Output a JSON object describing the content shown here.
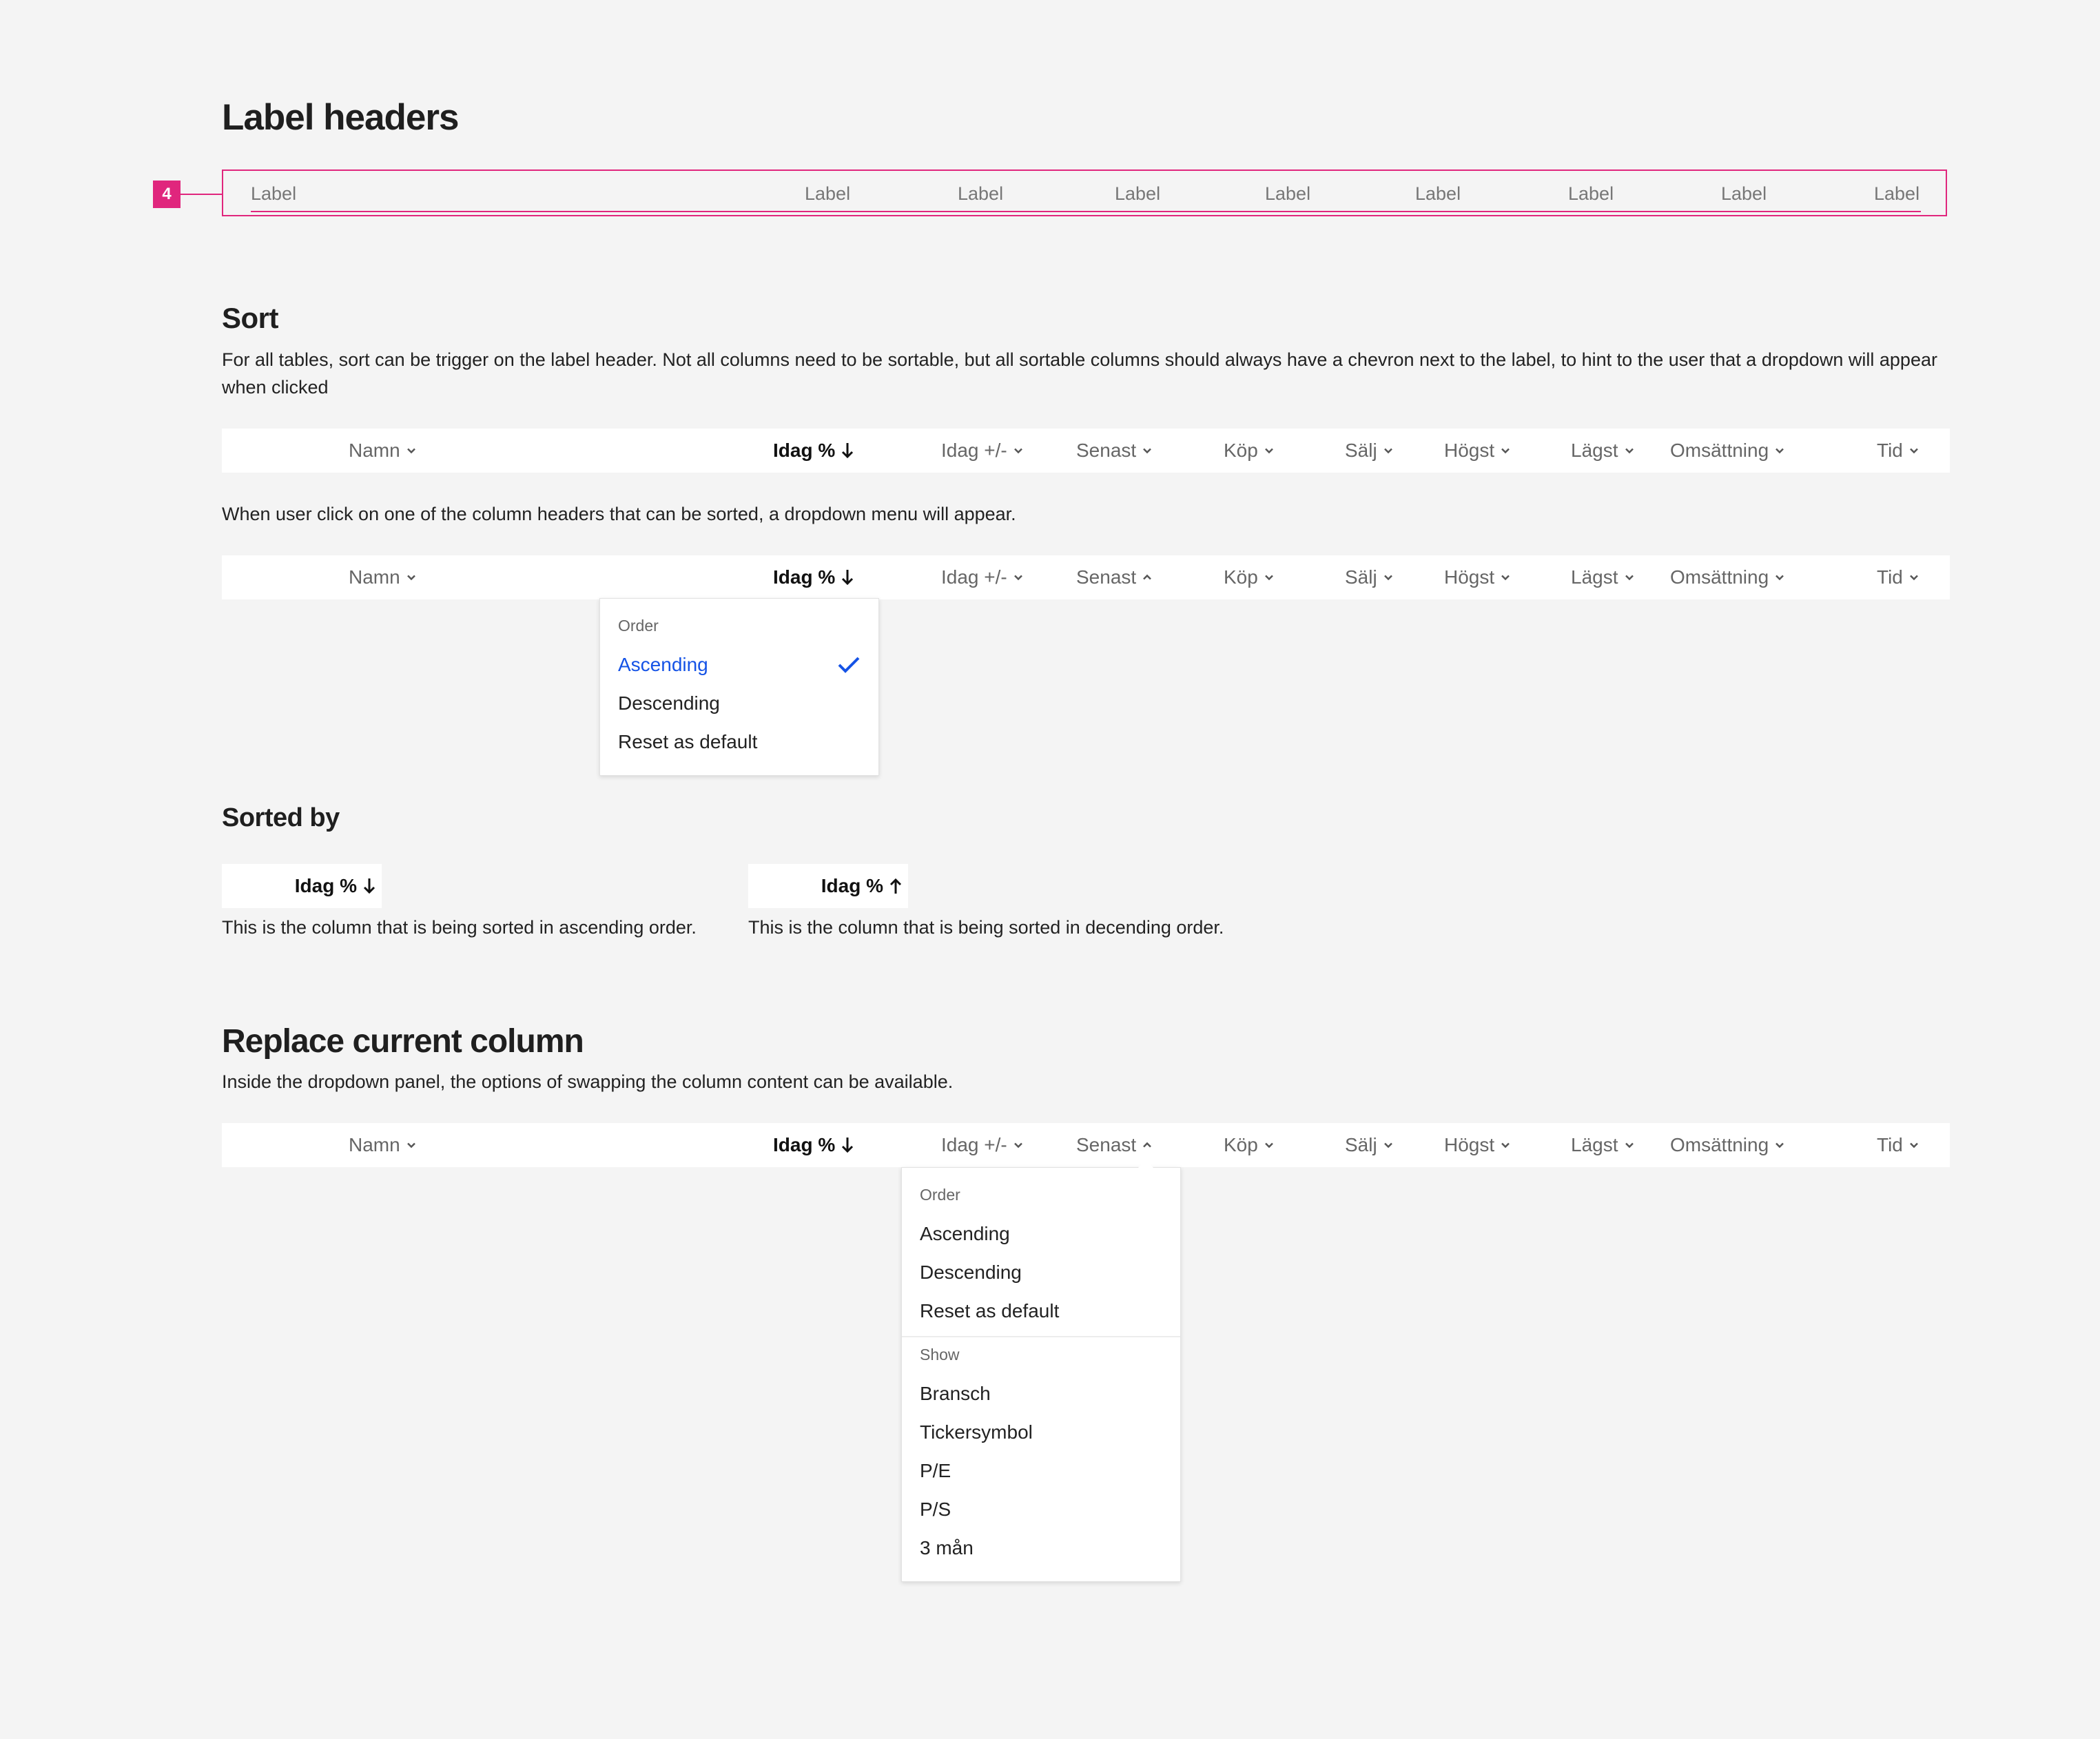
{
  "sections": {
    "label_headers": {
      "title": "Label headers",
      "marker": "4",
      "labels": [
        "Label",
        "Label",
        "Label",
        "Label",
        "Label",
        "Label",
        "Label",
        "Label",
        "Label"
      ]
    },
    "sort": {
      "title": "Sort",
      "description": "For all tables, sort can be trigger on the label header. Not all columns need to be sortable, but all sortable columns should always have a chevron next to the label, to hint to the user that a dropdown will appear when clicked",
      "note": "When user click on one of the column headers that can be sorted, a dropdown menu will appear."
    },
    "sorted_by": {
      "title": "Sorted by",
      "ascending_chip": "Idag %",
      "descending_chip": "Idag %",
      "ascending_caption": "This is the column that is being sorted in ascending order.",
      "descending_caption": "This is the column that is being sorted in decending order."
    },
    "replace": {
      "title": "Replace current column",
      "description": "Inside the dropdown panel, the options of swapping the column content can be available."
    }
  },
  "columns": {
    "namn": "Namn",
    "idag_pct": "Idag %",
    "idag_diff": "Idag +/-",
    "senast": "Senast",
    "kop": "Köp",
    "salj": "Sälj",
    "hogst": "Högst",
    "lagst": "Lägst",
    "omsattning": "Omsättning",
    "tid": "Tid"
  },
  "sort_dropdown": {
    "group_label": "Order",
    "items": [
      "Ascending",
      "Descending",
      "Reset as default"
    ],
    "selected": "Ascending"
  },
  "replace_dropdown": {
    "order_label": "Order",
    "order_items": [
      "Ascending",
      "Descending",
      "Reset as default"
    ],
    "show_label": "Show",
    "show_items": [
      "Bransch",
      "Tickersymbol",
      "P/E",
      "P/S",
      "3 mån"
    ]
  },
  "icons": {
    "chevron": "chevron-down-icon",
    "sort_desc": "arrow-down-icon",
    "sort_asc": "arrow-up-icon",
    "check": "check-icon"
  },
  "colors": {
    "accent_pink": "#e0267d",
    "link_blue": "#1553e6",
    "background": "#f4f4f4"
  }
}
